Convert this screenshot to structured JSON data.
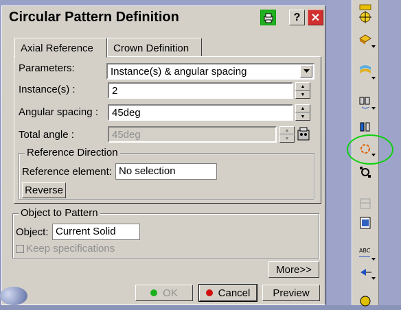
{
  "window": {
    "title": "Circular Pattern Definition",
    "help_label": "?",
    "close_label": "✕"
  },
  "tabs": [
    {
      "label": "Axial Reference",
      "active": true
    },
    {
      "label": "Crown Definition",
      "active": false
    }
  ],
  "axial": {
    "parameters_label": "Parameters:",
    "parameters_value": "Instance(s) & angular spacing",
    "instances_label": "Instance(s) :",
    "instances_value": "2",
    "angular_spacing_label": "Angular spacing :",
    "angular_spacing_value": "45deg",
    "total_angle_label": "Total angle :",
    "total_angle_value": "45deg"
  },
  "reference_direction": {
    "title": "Reference Direction",
    "element_label": "Reference element:",
    "element_value": "No selection",
    "reverse_label": "Reverse"
  },
  "object_to_pattern": {
    "title": "Object to Pattern",
    "object_label": "Object:",
    "object_value": "Current Solid",
    "keep_spec_label": "Keep specifications"
  },
  "buttons": {
    "more": "More>>",
    "ok": "OK",
    "cancel": "Cancel",
    "preview": "Preview"
  },
  "colors": {
    "dialog_bg": "#d4d0c8",
    "highlight_ellipse": "#10d010",
    "ok_dot": "#1bb01b",
    "cancel_dot": "#d01010"
  },
  "toolbar_icons": [
    "frame-icon",
    "pocket-icon",
    "surface-icon",
    "mirror-icon",
    "rectangular-pattern-icon",
    "circular-pattern-icon",
    "user-pattern-icon",
    "scale-icon",
    "thickness-icon",
    "annotation-icon",
    "arrow-icon",
    "material-icon"
  ]
}
